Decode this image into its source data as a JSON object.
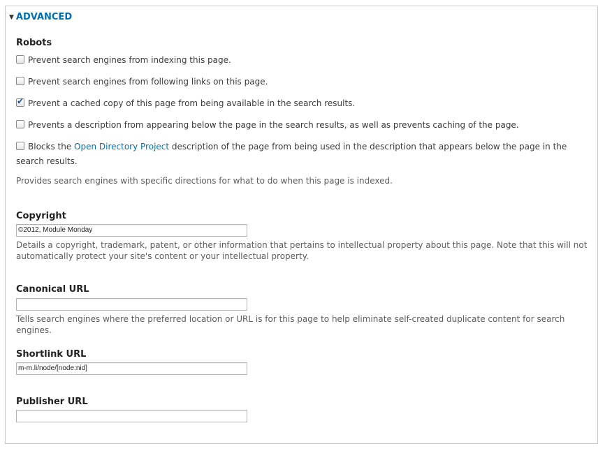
{
  "section": {
    "title": "ADVANCED"
  },
  "robots": {
    "label": "Robots",
    "options": [
      {
        "text": "Prevent search engines from indexing this page.",
        "checked": false
      },
      {
        "text": "Prevent search engines from following links on this page.",
        "checked": false
      },
      {
        "text": "Prevent a cached copy of this page from being available in the search results.",
        "checked": true
      },
      {
        "text": "Prevents a description from appearing below the page in the search results, as well as prevents caching of the page.",
        "checked": false
      },
      {
        "text_before": "Blocks the",
        "link": "Open Directory Project",
        "text_after": "description of the page from being used in the description that appears below the page in the search results.",
        "checked": false
      }
    ],
    "description": "Provides search engines with specific directions for what to do when this page is indexed."
  },
  "copyright": {
    "label": "Copyright",
    "value": "©2012, Module Monday",
    "description": "Details a copyright, trademark, patent, or other information that pertains to intellectual property about this page. Note that this will not automatically protect your site's content or your intellectual property."
  },
  "canonical": {
    "label": "Canonical URL",
    "value": "",
    "description": "Tells search engines where the preferred location or URL is for this page to help eliminate self-created duplicate content for search engines."
  },
  "shortlink": {
    "label": "Shortlink URL",
    "value": "m-m.li/node/[node:nid]"
  },
  "publisher": {
    "label": "Publisher URL",
    "value": ""
  },
  "colors": {
    "link": "#0071b3",
    "border": "#c8c8c8"
  }
}
